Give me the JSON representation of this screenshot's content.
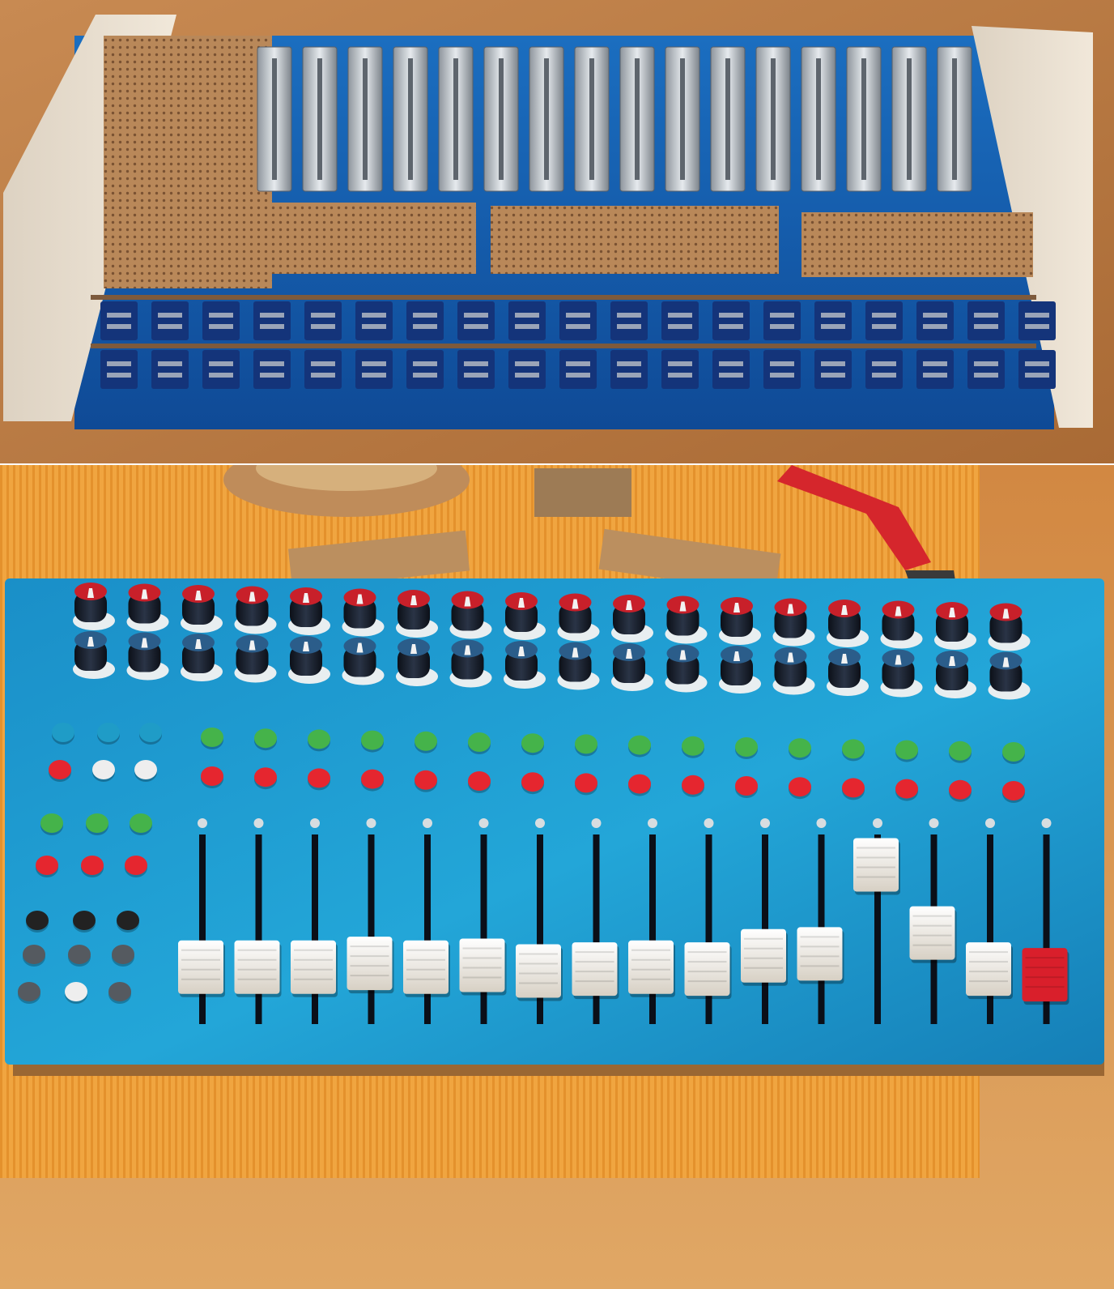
{
  "photos": [
    {
      "name": "controller-back-wiring",
      "view": "underside"
    },
    {
      "name": "controller-front-panel",
      "view": "top"
    }
  ],
  "controller": {
    "fader_count": 16,
    "knob_rows": 2,
    "knobs_per_row": 18,
    "fader_levels": [
      0.3,
      0.3,
      0.3,
      0.32,
      0.3,
      0.31,
      0.28,
      0.29,
      0.3,
      0.29,
      0.36,
      0.37,
      0.84,
      0.48,
      0.29,
      0.26
    ],
    "fader_cap_colors": [
      "#f0ebe3",
      "#f0ebe3",
      "#f0ebe3",
      "#f0ebe3",
      "#f0ebe3",
      "#f0ebe3",
      "#f0ebe3",
      "#f0ebe3",
      "#f0ebe3",
      "#f0ebe3",
      "#f0ebe3",
      "#f0ebe3",
      "#f0ebe3",
      "#f0ebe3",
      "#f0ebe3",
      "#d91f2b"
    ],
    "panel_color": "#1a8fc8",
    "wood_color": "#e2a664"
  },
  "colors": {
    "knob_body": "#1a2030",
    "knob_red_cap": "#c8202a",
    "knob_blue_cap": "#2b5d8a",
    "button_red": "#e5262f",
    "button_green": "#45b34a",
    "button_cyan": "#1f9cc7",
    "button_white": "#eeeeee",
    "button_black": "#222222",
    "button_gray": "#555a60",
    "pcb": "#b98859",
    "steel": "#c9ced4",
    "jack_blue": "#14347a"
  }
}
